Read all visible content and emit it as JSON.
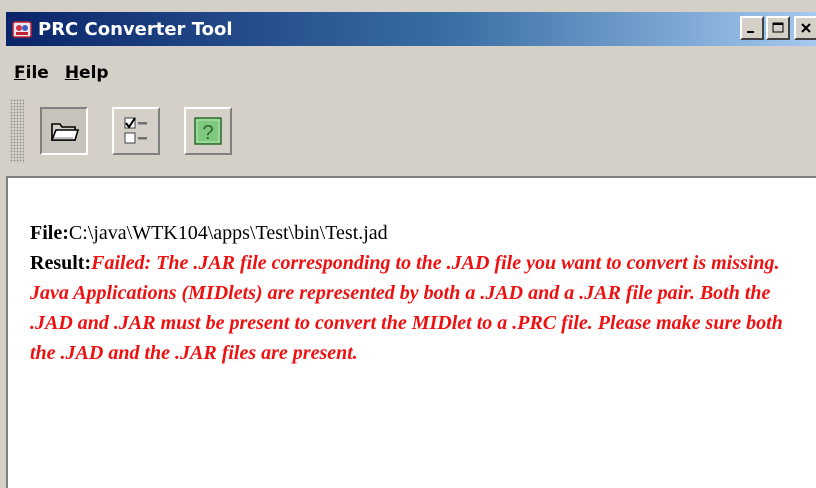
{
  "window": {
    "title": "PRC Converter Tool",
    "caption_buttons": {
      "minimize": "_",
      "maximize": "□",
      "close": "×"
    }
  },
  "menu": {
    "items": [
      {
        "label": "File",
        "mnemonic": "F",
        "rest": "ile"
      },
      {
        "label": "Help",
        "mnemonic": "H",
        "rest": "elp"
      }
    ]
  },
  "toolbar": {
    "buttons": [
      {
        "name": "open-folder-icon",
        "pressed": true
      },
      {
        "name": "checklist-icon",
        "pressed": false
      },
      {
        "name": "help-icon",
        "pressed": false
      }
    ]
  },
  "content": {
    "file_label": "File:",
    "file_path": "C:\\java\\WTK104\\apps\\Test\\bin\\Test.jad",
    "result_label": "Result:",
    "result_message": "Failed: The .JAR file corresponding to the .JAD file you want to convert is missing. Java Applications (MIDlets) are represented by both a .JAD and a .JAR file pair. Both the .JAD and .JAR must be present to convert the MIDlet to a .PRC file. Please make sure both the .JAD and the .JAR files are present."
  },
  "colors": {
    "title_bar_start": "#0a246a",
    "title_bar_end": "#a6caf0",
    "window_face": "#d4d0c8",
    "error_text": "#ee1111"
  }
}
